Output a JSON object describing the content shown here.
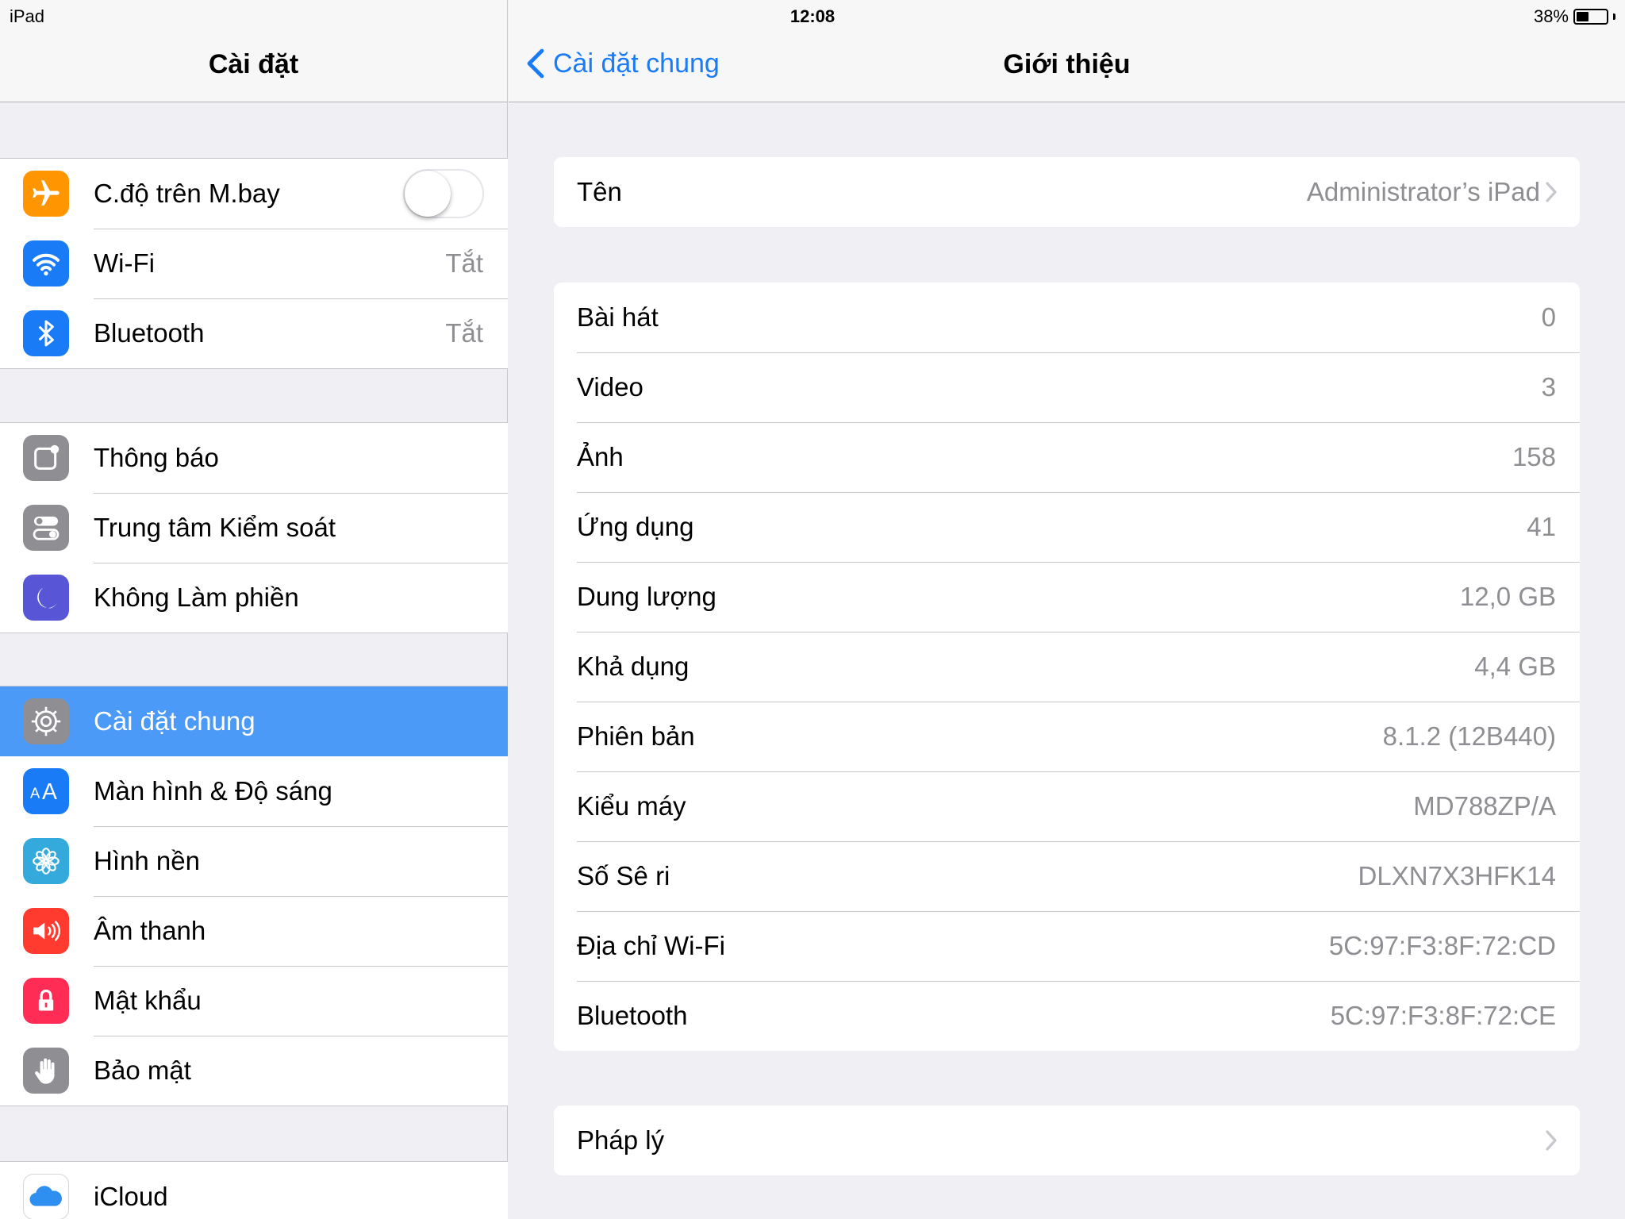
{
  "status": {
    "device": "iPad",
    "time": "12:08",
    "battery": "38%"
  },
  "left": {
    "title": "Cài đặt",
    "groups": [
      [
        {
          "label": "C.độ trên M.bay",
          "icon": "airplane-icon",
          "color": "#ff9500",
          "toggle": false
        },
        {
          "label": "Wi-Fi",
          "icon": "wifi-icon",
          "color": "#1a7bf6",
          "value": "Tắt"
        },
        {
          "label": "Bluetooth",
          "icon": "bluetooth-icon",
          "color": "#1a7bf6",
          "value": "Tắt"
        }
      ],
      [
        {
          "label": "Thông báo",
          "icon": "notifications-icon",
          "color": "#8e8e93"
        },
        {
          "label": "Trung tâm Kiểm soát",
          "icon": "control-center-icon",
          "color": "#8e8e93"
        },
        {
          "label": "Không Làm phiền",
          "icon": "moon-icon",
          "color": "#5856d6"
        }
      ],
      [
        {
          "label": "Cài đặt chung",
          "icon": "gear-icon",
          "color": "#8e8e93",
          "selected": true
        },
        {
          "label": "Màn hình & Độ sáng",
          "icon": "display-brightness-icon",
          "color": "#1a7bf6"
        },
        {
          "label": "Hình nền",
          "icon": "wallpaper-flower-icon",
          "color": "#34aadc"
        },
        {
          "label": "Âm thanh",
          "icon": "speaker-icon",
          "color": "#ff3b30"
        },
        {
          "label": "Mật khẩu",
          "icon": "lock-icon",
          "color": "#ff2d55"
        },
        {
          "label": "Bảo mật",
          "icon": "hand-icon",
          "color": "#8e8e93"
        }
      ],
      [
        {
          "label": "iCloud",
          "icon": "icloud-icon",
          "color": "#ffffff"
        }
      ]
    ]
  },
  "right": {
    "back_label": "Cài đặt chung",
    "title": "Giới thiệu",
    "name_row": {
      "label": "Tên",
      "value": "Administrator’s iPad"
    },
    "info_rows": [
      {
        "label": "Bài hát",
        "value": "0"
      },
      {
        "label": "Video",
        "value": "3"
      },
      {
        "label": "Ảnh",
        "value": "158"
      },
      {
        "label": "Ứng dụng",
        "value": "41"
      },
      {
        "label": "Dung lượng",
        "value": "12,0 GB"
      },
      {
        "label": "Khả dụng",
        "value": "4,4 GB"
      },
      {
        "label": "Phiên bản",
        "value": "8.1.2 (12B440)"
      },
      {
        "label": "Kiểu máy",
        "value": "MD788ZP/A"
      },
      {
        "label": "Số Sê ri",
        "value": "DLXN7X3HFK14"
      },
      {
        "label": "Địa chỉ Wi-Fi",
        "value": "5C:97:F3:8F:72:CD"
      },
      {
        "label": "Bluetooth",
        "value": "5C:97:F3:8F:72:CE"
      }
    ],
    "legal_row": {
      "label": "Pháp lý"
    }
  }
}
